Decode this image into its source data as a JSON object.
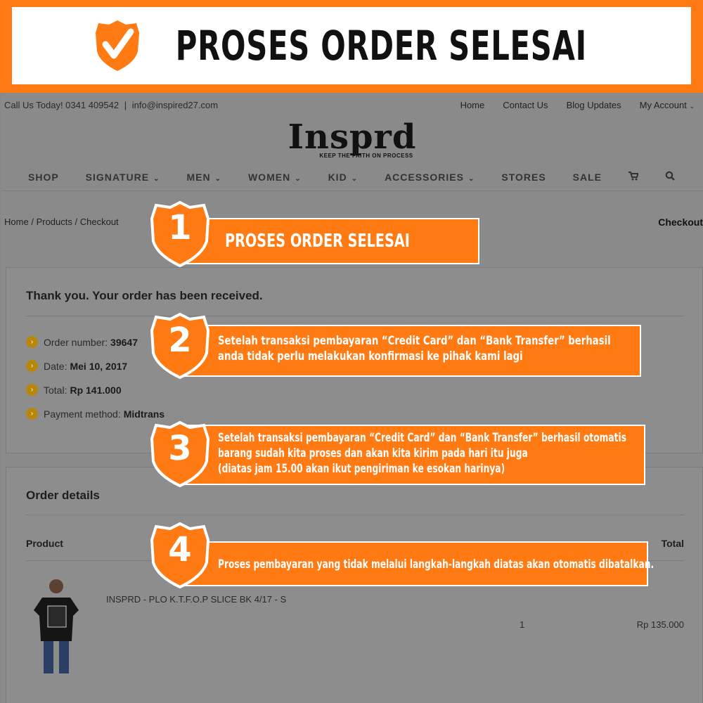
{
  "banner": {
    "title": "PROSES ORDER SELESAI",
    "icon": "check-shield-icon",
    "accent": "#ff7a12"
  },
  "topbar": {
    "phone": "Call Us Today! 0341 409542",
    "sep": "|",
    "email": "info@inspired27.com",
    "links": [
      "Home",
      "Contact Us",
      "Blog Updates",
      "My Account"
    ]
  },
  "logo": {
    "text": "Insprd",
    "tagline": "KEEP THE FAITH ON PROCESS"
  },
  "nav": [
    "SHOP",
    "SIGNATURE",
    "MEN",
    "WOMEN",
    "KID",
    "ACCESSORIES",
    "STORES",
    "SALE"
  ],
  "breadcrumb": {
    "items": [
      "Home",
      "Products",
      "Checkout"
    ],
    "sep": "/",
    "page_title": "Checkout"
  },
  "order": {
    "heading": "Thank you. Your order has been received.",
    "number_label": "Order number:",
    "number": "39647",
    "date_label": "Date:",
    "date": "Mei 10, 2017",
    "total_label": "Total:",
    "total": "Rp 141.000",
    "payment_label": "Payment method:",
    "payment": "Midtrans"
  },
  "details": {
    "heading": "Order details",
    "col_product": "Product",
    "col_total": "Total",
    "product_name": "INSPRD - PLO K.T.F.O.P SLICE BK 4/17 - S",
    "qty": "1",
    "line_total": "Rp 135.000"
  },
  "steps": [
    {
      "num": "1",
      "lines": [
        "PROSES ORDER SELESAI"
      ]
    },
    {
      "num": "2",
      "lines": [
        "Setelah transaksi pembayaran “Credit Card” dan “Bank Transfer” berhasil",
        "anda tidak perlu melakukan konfirmasi ke pihak kami lagi"
      ]
    },
    {
      "num": "3",
      "lines": [
        "Setelah transaksi pembayaran “Credit Card” dan “Bank Transfer” berhasil otomatis",
        "barang sudah kita proses dan akan kita kirim pada hari itu juga",
        "(diatas jam 15.00 akan ikut pengiriman ke esokan harinya)"
      ]
    },
    {
      "num": "4",
      "lines": [
        "Proses pembayaran yang tidak melalui langkah-langkah diatas akan otomatis dibatalkan."
      ]
    }
  ]
}
